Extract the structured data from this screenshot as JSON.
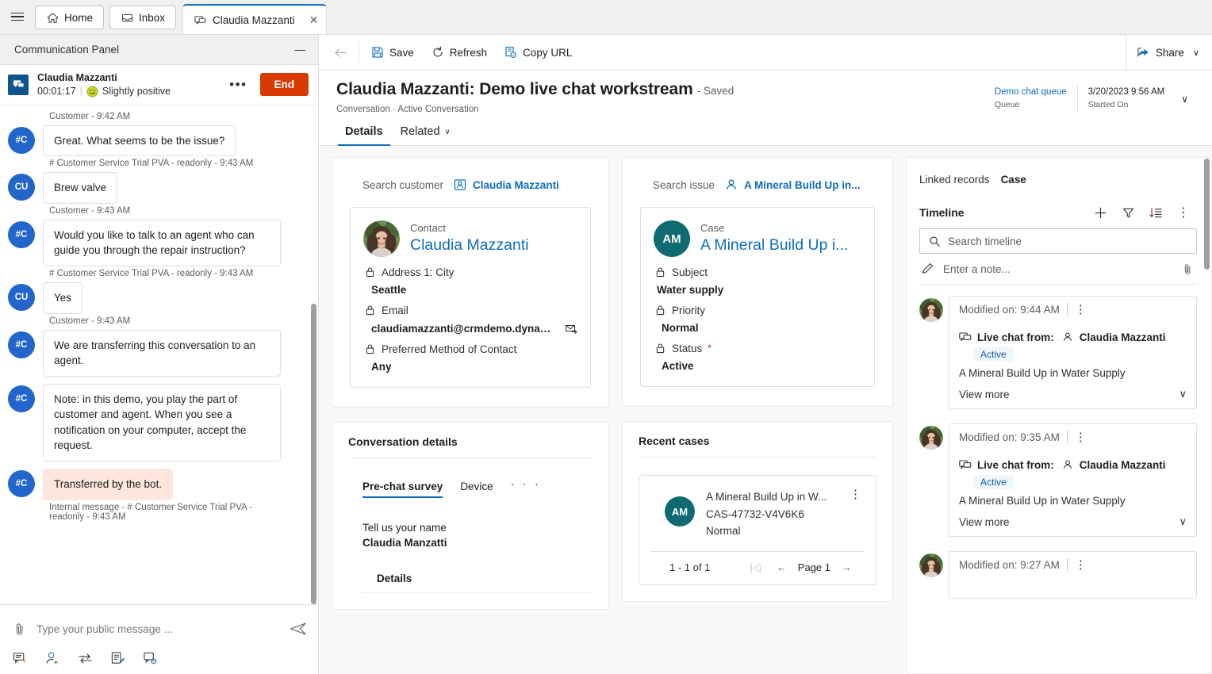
{
  "window": {
    "tabs": [
      {
        "label": "Home",
        "icon": "home-icon"
      },
      {
        "label": "Inbox",
        "icon": "inbox-icon"
      }
    ],
    "active_tab": {
      "label": "Claudia Mazzanti",
      "icon": "chat-icon",
      "close": "✕"
    }
  },
  "communication_panel": {
    "title": "Communication Panel",
    "minimize": "—",
    "conversation": {
      "customer_name": "Claudia Mazzanti",
      "duration": "00:01:17",
      "separator": "|",
      "sentiment": "Slightly positive",
      "more": "•••",
      "end_label": "End"
    },
    "messages": [
      {
        "stamp": "Customer - 9:42 AM",
        "stamp_pos": "above",
        "initials": "#C",
        "text": "Great. What seems to be the issue?",
        "after": "# Customer Service Trial PVA - readonly - 9:43 AM",
        "kind": "normal"
      },
      {
        "initials": "CU",
        "text": "Brew valve",
        "after": "Customer - 9:43 AM",
        "kind": "normal"
      },
      {
        "initials": "#C",
        "text": "Would you like to talk to an agent who can guide you through the repair instruction?",
        "after": "# Customer Service Trial PVA - readonly - 9:43 AM",
        "kind": "normal"
      },
      {
        "initials": "CU",
        "text": "Yes",
        "after": "Customer - 9:43 AM",
        "kind": "normal"
      },
      {
        "initials": "#C",
        "text": "We are transferring this conversation to an agent.",
        "after": "",
        "kind": "normal"
      },
      {
        "initials": "#C",
        "text": "Note: in this demo, you play the part of customer and agent. When you see a notification on your computer, accept the request.",
        "after": "",
        "kind": "normal"
      },
      {
        "initials": "#C",
        "text": "Transferred by the bot.",
        "after": "Internal message - # Customer Service Trial PVA - readonly - 9:43 AM",
        "kind": "internal"
      }
    ],
    "composer": {
      "placeholder": "Type your public message ...",
      "value": "",
      "attach_icon": "paperclip-icon",
      "send_icon": "send-icon",
      "tools": [
        "quick-replies-icon",
        "add-agent-icon",
        "transfer-icon",
        "notes-icon",
        "consult-icon"
      ]
    }
  },
  "command_bar": {
    "back": "back-arrow-icon",
    "buttons": [
      {
        "label": "Save",
        "icon": "save-icon"
      },
      {
        "label": "Refresh",
        "icon": "refresh-icon"
      },
      {
        "label": "Copy URL",
        "icon": "copy-url-icon"
      }
    ],
    "share": {
      "label": "Share",
      "icon": "share-icon",
      "chevron": "∨"
    }
  },
  "record": {
    "title": "Claudia Mazzanti: Demo live chat workstream",
    "saved_state": "- Saved",
    "breadcrumb": "Conversation · Active Conversation",
    "header_fields": [
      {
        "value": "Demo chat queue",
        "label": "Queue",
        "link": true
      },
      {
        "value": "3/20/2023 9:56 AM",
        "label": "Started On",
        "link": false
      }
    ],
    "header_chevron": "∨",
    "tabs": [
      {
        "label": "Details",
        "active": true,
        "chevron": ""
      },
      {
        "label": "Related",
        "active": false,
        "chevron": "∨"
      }
    ]
  },
  "customer_panel": {
    "search_label": "Search customer",
    "search_value": "Claudia Mazzanti",
    "search_icon": "contact-icon",
    "card": {
      "type": "Contact",
      "name": "Claudia Mazzanti",
      "avatar": "contact-photo",
      "fields": [
        {
          "label": "Address 1: City",
          "value": "Seattle",
          "locked": true,
          "required": false,
          "trailing_icon": ""
        },
        {
          "label": "Email",
          "value": "claudiamazzanti@crmdemo.dynamics....",
          "locked": true,
          "required": false,
          "trailing_icon": "email-icon"
        },
        {
          "label": "Preferred Method of Contact",
          "value": "Any",
          "locked": true,
          "required": false,
          "trailing_icon": ""
        }
      ]
    }
  },
  "issue_panel": {
    "search_label": "Search issue",
    "search_value": "A Mineral Build Up in...",
    "search_icon": "person-icon",
    "card": {
      "type": "Case",
      "name": "A Mineral Build Up i...",
      "initials": "AM",
      "avatar_color": "#0f6a72",
      "fields": [
        {
          "label": "Subject",
          "value": "Water supply",
          "locked": true,
          "required": false,
          "trailing_icon": ""
        },
        {
          "label": "Priority",
          "value": "Normal",
          "locked": true,
          "required": false,
          "trailing_icon": ""
        },
        {
          "label": "Status",
          "value": "Active",
          "locked": true,
          "required": true,
          "trailing_icon": ""
        }
      ]
    }
  },
  "conversation_details": {
    "title": "Conversation details",
    "tabs": [
      {
        "label": "Pre-chat survey",
        "active": true
      },
      {
        "label": "Device",
        "active": false
      },
      {
        "label": "· · ·",
        "active": false,
        "is_overflow": true
      }
    ],
    "survey": {
      "question": "Tell us your name",
      "answer": "Claudia Manzatti"
    },
    "details_header": "Details"
  },
  "recent_cases": {
    "title": "Recent cases",
    "items": [
      {
        "initials": "AM",
        "title": "A Mineral Build Up in W...",
        "number": "CAS-47732-V4V6K6",
        "priority": "Normal",
        "more": "⋮"
      }
    ],
    "pager": {
      "count": "1 - 1 of 1",
      "first": "|◁",
      "prev": "←",
      "page": "Page 1",
      "next": "→"
    }
  },
  "timeline_panel": {
    "linked_records_label": "Linked records",
    "linked_records_value": "Case",
    "title": "Timeline",
    "actions": [
      {
        "name": "add-icon",
        "glyph": "+"
      },
      {
        "name": "filter-icon",
        "glyph": "∇"
      },
      {
        "name": "sort-icon",
        "glyph": "↓≡"
      },
      {
        "name": "more-icon",
        "glyph": "⋮"
      }
    ],
    "search_placeholder": "Search timeline",
    "search_value": "",
    "note_placeholder": "Enter a note...",
    "note_attach": "paperclip-icon",
    "entries": [
      {
        "modified": "Modified on: 9:44 AM",
        "more": "⋮",
        "from_label": "Live chat from:",
        "from_person": "Claudia Mazzanti",
        "status": "Active",
        "description": "A Mineral Build Up in Water Supply",
        "view_more": "View more",
        "chevron": "∨"
      },
      {
        "modified": "Modified on: 9:35 AM",
        "more": "⋮",
        "from_label": "Live chat from:",
        "from_person": "Claudia Mazzanti",
        "status": "Active",
        "description": "A Mineral Build Up in Water Supply",
        "view_more": "View more",
        "chevron": "∨"
      },
      {
        "modified": "Modified on: 9:27 AM",
        "more": "⋮",
        "from_label": "",
        "from_person": "",
        "status": "",
        "description": "",
        "view_more": "",
        "chevron": ""
      }
    ]
  },
  "colors": {
    "accent": "#0f6cbd",
    "end_button": "#d83b01",
    "case_teal": "#0f6a72",
    "avatar_blue": "#2266cc",
    "internal_message": "#fde7dd",
    "badge_bg": "#eff6fc"
  }
}
